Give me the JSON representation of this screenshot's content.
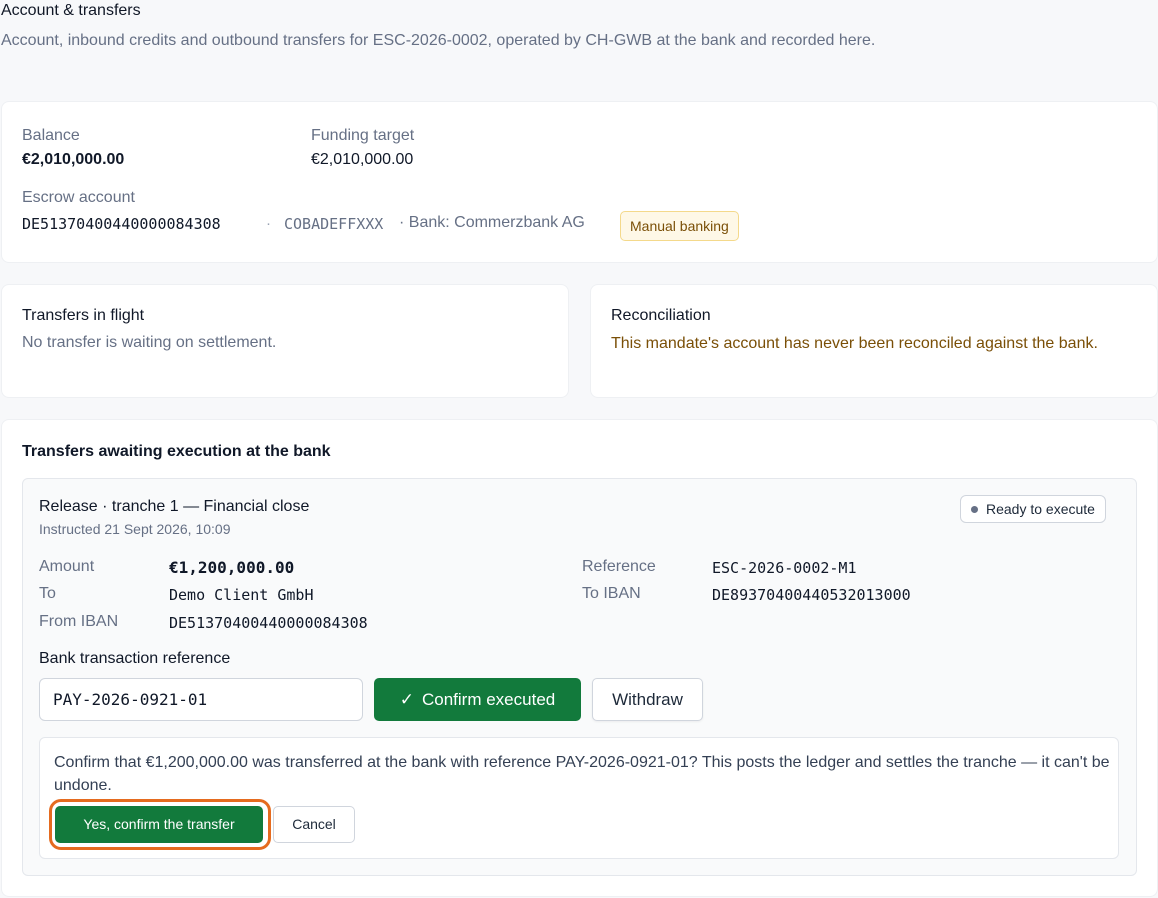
{
  "page": {
    "title": "Account & transfers",
    "subtitle": "Account, inbound credits and outbound transfers for ESC-2026-0002, operated by CH-GWB at the bank and recorded here."
  },
  "account": {
    "balance_label": "Balance",
    "balance_value": "€2,010,000.00",
    "target_label": "Funding target",
    "target_value": "€2,010,000.00",
    "escrow_label": "Escrow account",
    "iban": "DE51370400440000084308",
    "separator": "·",
    "bic": "COBADEFFXXX",
    "bank_text": "· Bank: Commerzbank AG",
    "badge": "Manual banking"
  },
  "in_flight": {
    "title": "Transfers in flight",
    "message": "No transfer is waiting on settlement."
  },
  "reconciliation": {
    "title": "Reconciliation",
    "message": "This mandate's account has never been reconciled against the bank."
  },
  "awaiting": {
    "title": "Transfers awaiting execution at the bank",
    "transfer": {
      "title": "Release · tranche 1 — Financial close",
      "instructed": "Instructed 21 Sept 2026, 10:09",
      "status": "Ready to execute",
      "amount_label": "Amount",
      "amount_value": "€1,200,000.00",
      "to_label": "To",
      "to_value": "Demo Client GmbH",
      "from_iban_label": "From IBAN",
      "from_iban_value": "DE51370400440000084308",
      "reference_label": "Reference",
      "reference_value": "ESC-2026-0002-M1",
      "to_iban_label": "To IBAN",
      "to_iban_value": "DE89370400440532013000",
      "bank_ref_label": "Bank transaction reference",
      "bank_ref_value": "PAY-2026-0921-01",
      "confirm_label": "Confirm executed",
      "withdraw_label": "Withdraw",
      "confirm_prompt": "Confirm that €1,200,000.00 was transferred at the bank with reference PAY-2026-0921-01? This posts the ledger and settles the tranche — it can't be undone.",
      "yes_label": "Yes, confirm the transfer",
      "cancel_label": "Cancel"
    }
  },
  "colors": {
    "primary_green": "#127a3c",
    "warning_text": "#7a4f07",
    "focus_ring": "#e56b1f"
  }
}
